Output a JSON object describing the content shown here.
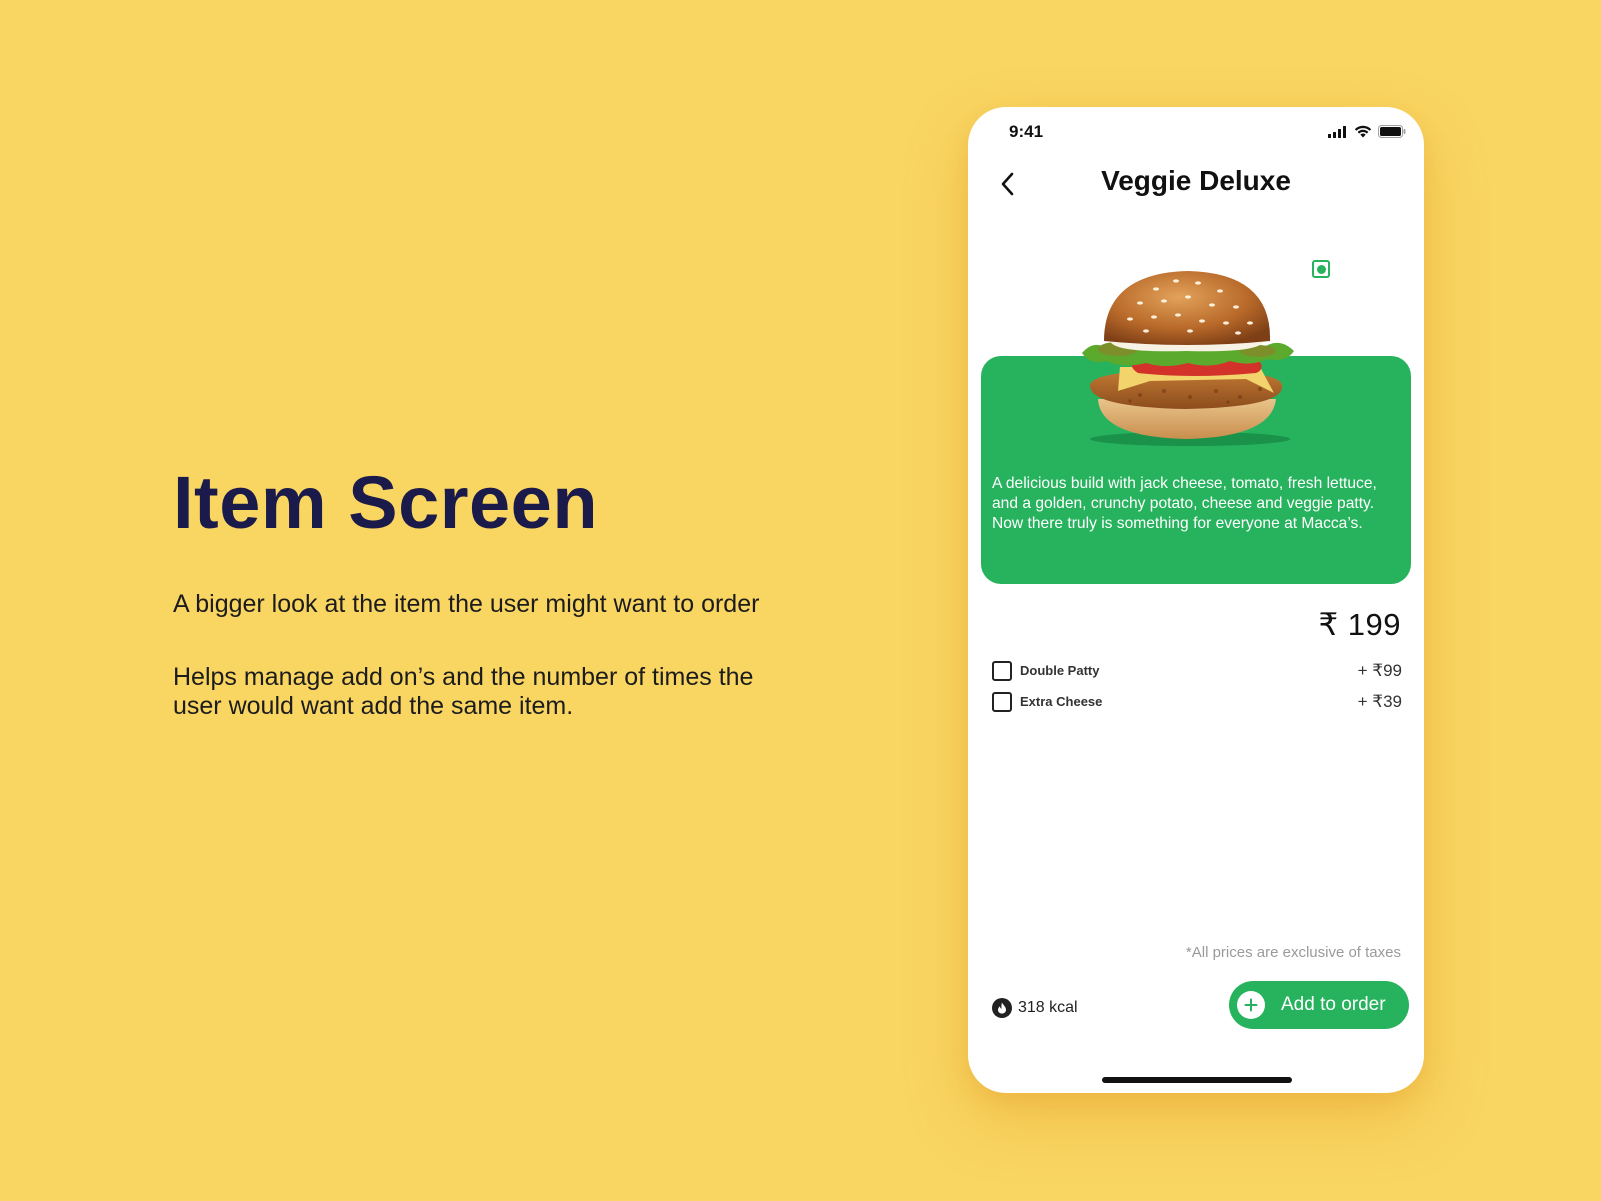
{
  "intro": {
    "title": "Item Screen",
    "paragraph_1": "A bigger look at the item the user might want to order",
    "paragraph_2": "Helps manage add on’s and the number of times the user would want add the same item."
  },
  "phone": {
    "status_bar": {
      "time": "9:41",
      "icons": [
        "cellular-signal-icon",
        "wifi-icon",
        "battery-icon"
      ]
    },
    "header": {
      "back_icon": "chevron-left-icon",
      "title": "Veggie Deluxe"
    },
    "item": {
      "veg_indicator": "veg-badge-icon",
      "image": "burger-image",
      "description": "A delicious build with jack cheese, tomato, fresh lettuce, and a golden, crunchy potato, cheese and veggie patty. Now there truly is something for everyone at Macca’s.",
      "price": "₹ 199"
    },
    "addons": [
      {
        "label": "Double Patty",
        "price": "+ ₹99",
        "checked": false
      },
      {
        "label": "Extra Cheese",
        "price": "+ ₹39",
        "checked": false
      }
    ],
    "footer": {
      "tax_note": "*All prices are exclusive of taxes",
      "kcal_icon": "flame-icon",
      "kcal": "318 kcal",
      "add_button_label": "Add to order",
      "add_icon": "plus-icon"
    }
  },
  "colors": {
    "background": "#F9D562",
    "heading": "#1B1B4B",
    "accent_green": "#27B35E",
    "phone_bg": "#FFFFFF"
  }
}
